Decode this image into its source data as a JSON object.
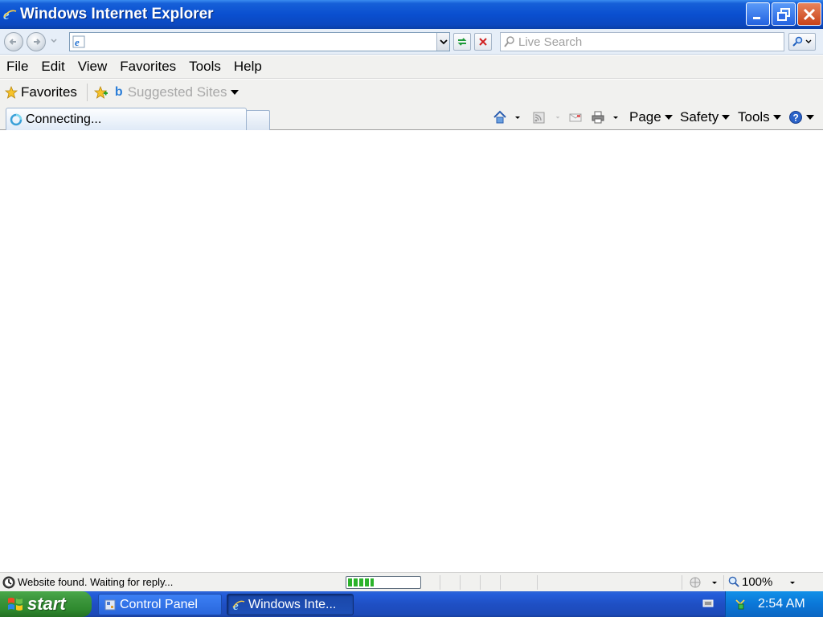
{
  "window": {
    "title": "Windows Internet Explorer"
  },
  "address_bar": {
    "value": "",
    "placeholder": ""
  },
  "search": {
    "placeholder": "Live Search"
  },
  "menu": {
    "items": [
      "File",
      "Edit",
      "View",
      "Favorites",
      "Tools",
      "Help"
    ]
  },
  "favorites_bar": {
    "favorites_label": "Favorites",
    "suggested_sites_label": "Suggested Sites"
  },
  "tab": {
    "label": "Connecting..."
  },
  "command_bar": {
    "page_label": "Page",
    "safety_label": "Safety",
    "tools_label": "Tools"
  },
  "status_bar": {
    "text": "Website found. Waiting for reply...",
    "progress": 0.36,
    "zoom": "100%"
  },
  "taskbar": {
    "start_label": "start",
    "tasks": [
      {
        "label": "Control Panel",
        "icon": "control-panel-icon"
      },
      {
        "label": "Windows Inte...",
        "icon": "ie-icon"
      }
    ],
    "clock": "2:54 AM"
  },
  "colors": {
    "titlebar": "#0a4fd0",
    "start_green": "#2f8a2f",
    "tray_blue": "#0b77d8",
    "progress_green": "#2bb22b"
  }
}
